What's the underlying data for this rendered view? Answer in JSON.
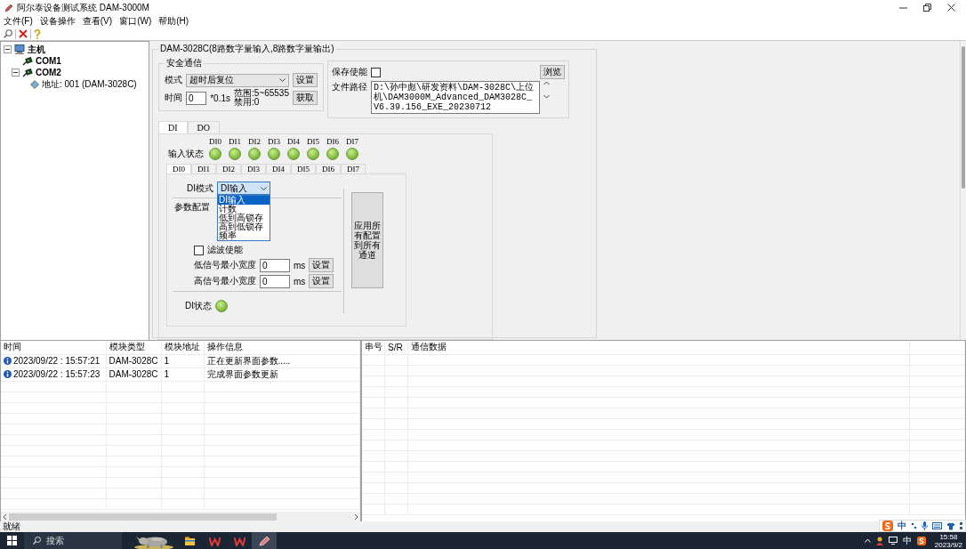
{
  "window": {
    "title": "阿尔泰设备测试系统 DAM-3000M"
  },
  "menu": [
    "文件(F)",
    "设备操作",
    "查看(V)",
    "窗口(W)",
    "帮助(H)"
  ],
  "tree": [
    {
      "label": "主机",
      "kind": "host",
      "expanded": true,
      "children": [
        {
          "label": "COM1",
          "kind": "port"
        },
        {
          "label": "COM2",
          "kind": "port",
          "expanded": true,
          "children": [
            {
              "label": "地址: 001 (DAM-3028C)",
              "kind": "device"
            }
          ]
        }
      ]
    }
  ],
  "module": {
    "title": "DAM-3028C(8路数字量输入,8路数字量输出)",
    "safe_comm": {
      "title": "安全通信",
      "mode_label": "模式",
      "mode_value": "超时后复位",
      "set_button": "设置",
      "time_label": "时间",
      "time_value": "0",
      "unit": "*0.1s",
      "range": "范围:5~65535",
      "disable_note": "禁用:0",
      "get_button": "获取"
    },
    "save": {
      "enable_label": "保存使能",
      "enabled": false,
      "browse_button": "浏览",
      "path_label": "文件路径",
      "path_value": "D:\\孙中彪\\研发资料\\DAM-3028C\\上位机\\DAM3000M_Advanced_DAM3028C_V6.39.156_EXE_20230712"
    },
    "tabs": [
      {
        "label": "DI",
        "selected": true
      },
      {
        "label": "DO",
        "selected": false
      }
    ],
    "input_status": {
      "label": "输入状态",
      "channels": [
        {
          "label": "DI0",
          "on": true
        },
        {
          "label": "DI1",
          "on": true
        },
        {
          "label": "DI2",
          "on": true
        },
        {
          "label": "DI3",
          "on": true
        },
        {
          "label": "DI4",
          "on": true
        },
        {
          "label": "DI5",
          "on": true
        },
        {
          "label": "DI6",
          "on": true
        },
        {
          "label": "DI7",
          "on": true
        }
      ]
    },
    "channel_tabs": [
      {
        "label": "DI0",
        "selected": true
      },
      {
        "label": "DI1",
        "selected": false
      },
      {
        "label": "DI2",
        "selected": false
      },
      {
        "label": "DI3",
        "selected": false
      },
      {
        "label": "DI4",
        "selected": false
      },
      {
        "label": "DI5",
        "selected": false
      },
      {
        "label": "DI6",
        "selected": false
      },
      {
        "label": "DI7",
        "selected": false
      }
    ],
    "di_mode": {
      "label": "DI模式",
      "value": "DI输入",
      "expanded": true,
      "options": [
        {
          "label": "DI输入",
          "selected": true
        },
        {
          "label": "计数",
          "selected": false
        },
        {
          "label": "低到高锁存",
          "selected": false
        },
        {
          "label": "高到低锁存",
          "selected": false
        },
        {
          "label": "频率",
          "selected": false
        }
      ]
    },
    "params": {
      "title": "参数配置",
      "filter": {
        "label": "滤波使能",
        "checked": false
      },
      "widths": [
        {
          "label": "低信号最小宽度",
          "value": "0",
          "unit": "ms",
          "button": "设置"
        },
        {
          "label": "高信号最小宽度",
          "value": "0",
          "unit": "ms",
          "button": "设置"
        }
      ]
    },
    "di_state": {
      "label": "DI状态",
      "on": true
    },
    "apply_button": "应用所有配置到所有通道"
  },
  "log": {
    "columns": [
      "时间",
      "模块类型",
      "模块地址",
      "操作信息"
    ],
    "rows": [
      {
        "kind": "info",
        "cells": [
          "2023/09/22 : 15:57:21",
          "DAM-3028C",
          "1",
          "正在更新界面参数....."
        ]
      },
      {
        "kind": "info",
        "cells": [
          "2023/09/22 : 15:57:23",
          "DAM-3028C",
          "1",
          "完成界面参数更新"
        ]
      }
    ]
  },
  "comm": {
    "columns": [
      "串号",
      "S/R",
      "通信数据"
    ]
  },
  "status_bar": {
    "text": "就绪"
  },
  "ime": {
    "mode": "中"
  },
  "taskbar": {
    "search_placeholder": "搜索",
    "tray_ime": "中",
    "time": "15:58",
    "date": "2023/9/2"
  }
}
